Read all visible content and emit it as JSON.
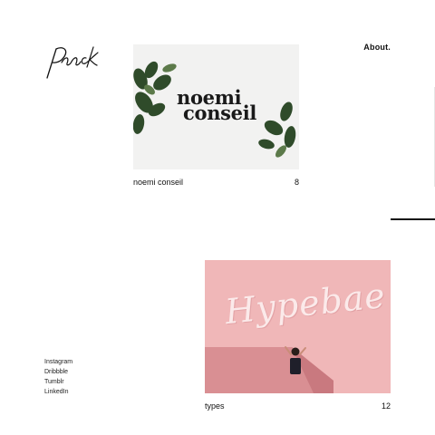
{
  "logo": {
    "text": "Paack"
  },
  "nav": {
    "about_label": "About."
  },
  "social": [
    "Instagram",
    "Dribbble",
    "Tumblr",
    "LinkedIn"
  ],
  "projects": [
    {
      "title": "noemi conseil",
      "count": "8",
      "image_text_line1": "noemi",
      "image_text_line2": "conseil"
    },
    {
      "title": "types",
      "count": "12",
      "image_text": "Hypebae"
    }
  ],
  "colors": {
    "text": "#111111",
    "pink": "#f0b7b8",
    "light_gray": "#f2f2f1",
    "leaf": "#2f4b2a"
  }
}
